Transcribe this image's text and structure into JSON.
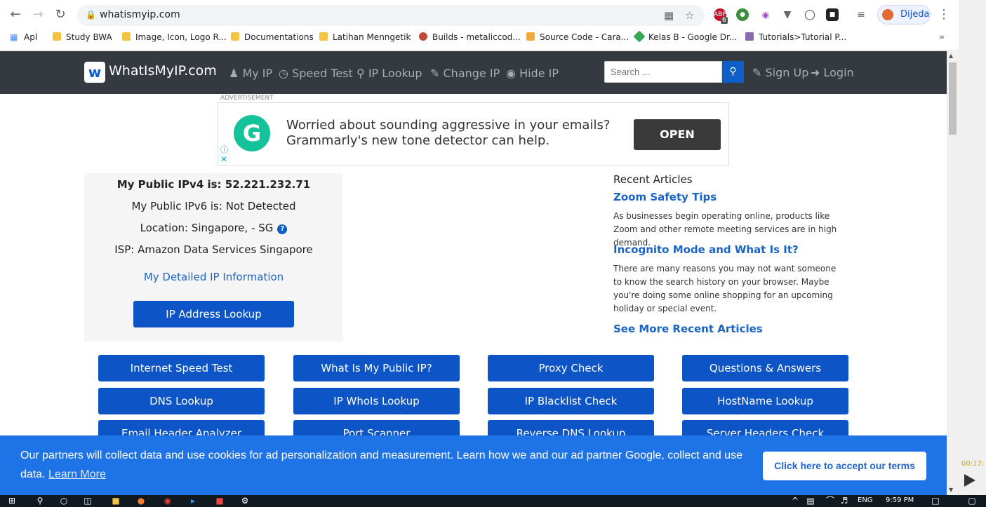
{
  "browser": {
    "url": "whatismyip.com",
    "profile_name": "Dijeda",
    "bookmarks": [
      "Apl",
      "Study BWA",
      "Image, Icon, Logo R...",
      "Documentations",
      "Latihan Menngetik",
      "Builds - metaliccod...",
      "Source Code - Cara...",
      "Kelas B - Google Dr...",
      "Tutorials>Tutorial P..."
    ],
    "extension_badge": "6"
  },
  "site": {
    "logo_text": "WhatIsMyIP.com",
    "nav": [
      "My IP",
      "Speed Test",
      "IP Lookup",
      "Change IP",
      "Hide IP"
    ],
    "search_placeholder": "Search ...",
    "signup": "Sign Up",
    "login": "Login"
  },
  "ad": {
    "label": "ADVERTISEMENT",
    "text": "Worried about sounding aggressive in your emails? Grammarly's new tone detector can help.",
    "open_label": "OPEN"
  },
  "ip": {
    "ipv4": "My Public IPv4 is: 52.221.232.71",
    "ipv6": "My Public IPv6 is: Not Detected",
    "location": "Location: Singapore, - SG",
    "isp": "ISP: Amazon Data Services Singapore",
    "detail_link": "My Detailed IP Information",
    "lookup_button": "IP Address Lookup"
  },
  "recent": {
    "title": "Recent Articles",
    "articles": [
      {
        "title": "Zoom Safety Tips",
        "desc": "As businesses begin operating online, products like Zoom and other remote meeting services are in high demand."
      },
      {
        "title": "Incognito Mode and What Is It?",
        "desc": "There are many reasons you may not want someone to know the search history on your browser. Maybe you're doing some online shopping for an upcoming holiday or special event."
      }
    ],
    "see_more": "See More Recent Articles"
  },
  "tools": [
    "Internet Speed Test",
    "What Is My Public IP?",
    "Proxy Check",
    "Questions & Answers",
    "DNS Lookup",
    "IP WhoIs Lookup",
    "IP Blacklist Check",
    "HostName Lookup",
    "Email Header Analyzer",
    "Port Scanner",
    "Reverse DNS Lookup",
    "Server Headers Check"
  ],
  "cookie": {
    "text": "Our partners will collect data and use cookies for ad personalization and measurement. Learn how we and our ad partner Google, collect and use data.",
    "learn_more": "Learn More",
    "accept": "Click here to accept our terms"
  },
  "side": {
    "timer": "00:17:"
  },
  "taskbar": {
    "lang": "ENG",
    "time": "9:59 PM"
  }
}
